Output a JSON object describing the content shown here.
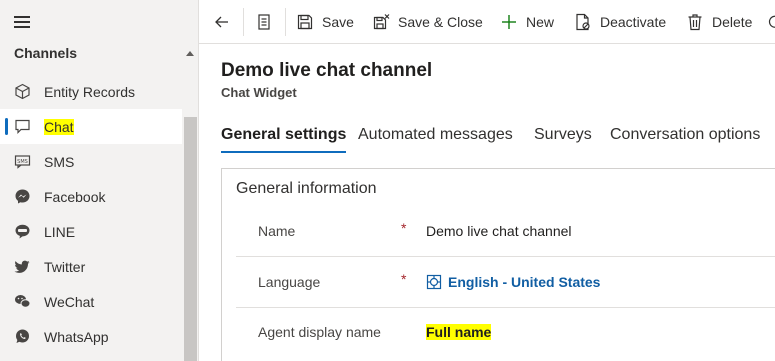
{
  "sidebar": {
    "section_title": "Channels",
    "items": [
      {
        "label": "Entity Records",
        "icon": "cube-icon"
      },
      {
        "label": "Chat",
        "icon": "chat-icon",
        "active": true
      },
      {
        "label": "SMS",
        "icon": "sms-icon"
      },
      {
        "label": "Facebook",
        "icon": "facebook-messenger-icon"
      },
      {
        "label": "LINE",
        "icon": "line-icon"
      },
      {
        "label": "Twitter",
        "icon": "twitter-icon"
      },
      {
        "label": "WeChat",
        "icon": "wechat-icon"
      },
      {
        "label": "WhatsApp",
        "icon": "whatsapp-icon"
      }
    ]
  },
  "toolbar": {
    "save_label": "Save",
    "save_close_label": "Save & Close",
    "new_label": "New",
    "deactivate_label": "Deactivate",
    "delete_label": "Delete"
  },
  "record": {
    "title": "Demo live chat channel",
    "entity": "Chat Widget"
  },
  "tabs": [
    {
      "label": "General settings",
      "active": true
    },
    {
      "label": "Automated messages"
    },
    {
      "label": "Surveys"
    },
    {
      "label": "Conversation options"
    }
  ],
  "form": {
    "section_title": "General information",
    "required_marker": "*",
    "fields": [
      {
        "label": "Name",
        "required": true,
        "value": "Demo live chat channel"
      },
      {
        "label": "Language",
        "required": true,
        "value": "English - United States",
        "is_link": true
      },
      {
        "label": "Agent display name",
        "required": false,
        "value": "Full name",
        "highlighted": true
      }
    ]
  },
  "colors": {
    "accent": "#0f6cbd",
    "highlight": "#ffff00",
    "link": "#115ea3",
    "required": "#a4262c",
    "sidebar_bg": "#f3f2f1"
  }
}
